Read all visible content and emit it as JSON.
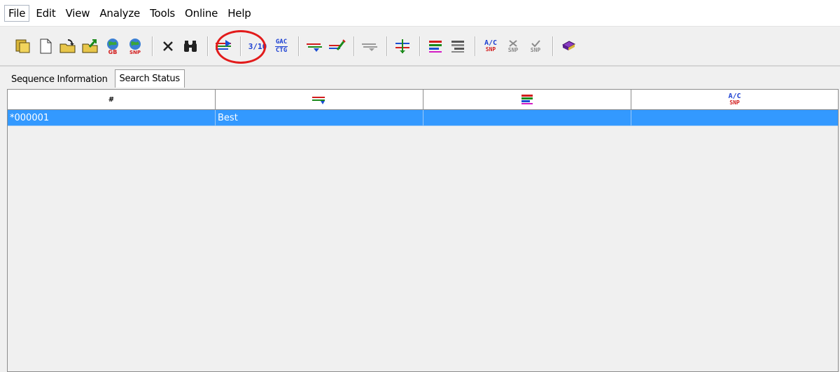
{
  "menu": [
    "File",
    "Edit",
    "View",
    "Analyze",
    "Tools",
    "Online",
    "Help"
  ],
  "toolbar": {
    "icons": [
      "open-folder-icon",
      "new-document-icon",
      "open-file-icon",
      "export-icon",
      "genbank-globe-icon",
      "snp-globe-icon",
      "delete-icon",
      "find-binoculars-icon",
      "run-search-icon",
      "ratio-icon",
      "reverse-complement-icon",
      "align-icon",
      "edit-align-icon",
      "disabled-align-icon",
      "merge-icon",
      "color-bars-icon",
      "gray-bars-icon",
      "snp-call-icon",
      "snp-delete-icon",
      "snp-accept-icon",
      "book-icon"
    ],
    "ratio_label": "3/10",
    "rc_top": "GAC",
    "rc_bottom": "CTG",
    "snp_label": "SNP",
    "ac_label": "A/C",
    "highlight_color": "#e21b1b"
  },
  "tabs": [
    {
      "label": "Sequence Information",
      "active": false
    },
    {
      "label": "Search Status",
      "active": true
    }
  ],
  "grid": {
    "header": {
      "col1": "#",
      "col4_top": "A/C",
      "col4_bottom": "SNP"
    },
    "rows": [
      {
        "id": "*000001",
        "status": "Best",
        "col3": "",
        "col4": ""
      }
    ],
    "selection_color": "#3399ff"
  }
}
